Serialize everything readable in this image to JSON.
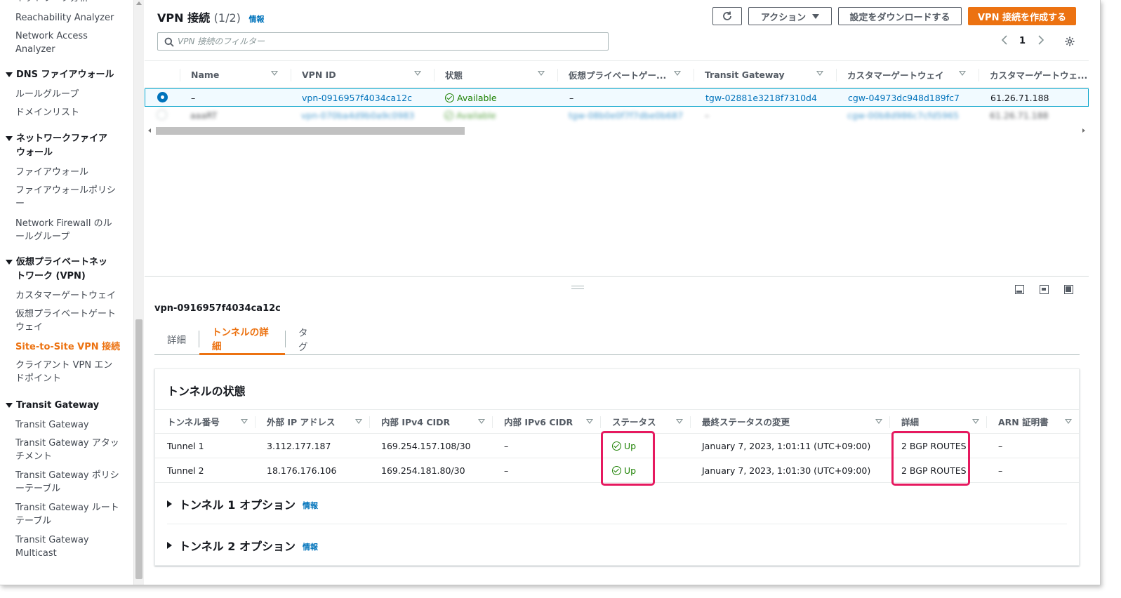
{
  "sidebar": {
    "items": [
      {
        "type": "item",
        "label": "Reachability Analyzer"
      },
      {
        "type": "item",
        "label": "Network Access Analyzer"
      },
      {
        "type": "head",
        "label": "DNS ファイアウォール"
      },
      {
        "type": "item",
        "label": "ルールグループ"
      },
      {
        "type": "item",
        "label": "ドメインリスト"
      },
      {
        "type": "head",
        "label": "ネットワークファイアウォール"
      },
      {
        "type": "item",
        "label": "ファイアウォール"
      },
      {
        "type": "item",
        "label": "ファイアウォールポリシー"
      },
      {
        "type": "item",
        "label": "Network Firewall のルールグループ"
      },
      {
        "type": "head",
        "label": "仮想プライベートネットワーク (VPN)"
      },
      {
        "type": "item",
        "label": "カスタマーゲートウェイ"
      },
      {
        "type": "item",
        "label": "仮想プライベートゲートウェイ"
      },
      {
        "type": "item",
        "label": "Site-to-Site VPN 接続",
        "active": true
      },
      {
        "type": "item",
        "label": "クライアント VPN エンドポイント"
      },
      {
        "type": "head",
        "label": "Transit Gateway"
      },
      {
        "type": "item",
        "label": "Transit Gateway"
      },
      {
        "type": "item",
        "label": "Transit Gateway アタッチメント"
      },
      {
        "type": "item",
        "label": "Transit Gateway ポリシーテーブル"
      },
      {
        "type": "item",
        "label": "Transit Gateway ルートテーブル"
      },
      {
        "type": "item",
        "label": "Transit Gateway Multicast"
      }
    ]
  },
  "header": {
    "title": "VPN 接続",
    "count": "(1/2)",
    "info": "情報",
    "actions_label": "アクション",
    "download_label": "設定をダウンロードする",
    "create_label": "VPN 接続を作成する"
  },
  "filter": {
    "placeholder": "VPN 接続のフィルター"
  },
  "pager": {
    "page": "1"
  },
  "grid": {
    "columns": [
      "Name",
      "VPN ID",
      "状態",
      "仮想プライベートゲー...",
      "Transit Gateway",
      "カスタマーゲートウェイ",
      "カスタマーゲートウェ..."
    ],
    "rows": [
      [
        "–",
        "vpn-0916957f4034ca12c",
        "Available",
        "–",
        "tgw-02881e3218f7310d4",
        "cgw-04973dc948d189fc7",
        "61.26.71.188"
      ],
      [
        "aaaRT",
        "vpn-070ba4d9b0a9c0983",
        "Available",
        "–",
        "tgw-08b0e0f7f7dbe0b687",
        "cgw-00b8d986c7cfd5965",
        "61.26.71.188"
      ]
    ]
  },
  "detail": {
    "id": "vpn-0916957f4034ca12c",
    "tabs": [
      "詳細",
      "トンネルの詳細",
      "タグ"
    ],
    "active_tab": 1,
    "container_title": "トンネルの状態",
    "columns": [
      "トンネル番号",
      "外部 IP アドレス",
      "内部 IPv4 CIDR",
      "内部 IPv6 CIDR",
      "ステータス",
      "最終ステータスの変更",
      "詳細",
      "ARN 証明書"
    ],
    "rows": [
      [
        "Tunnel 1",
        "3.112.177.187",
        "169.254.157.108/30",
        "–",
        "Up",
        "January 7, 2023, 1:01:11 (UTC+09:00)",
        "2 BGP ROUTES",
        "–"
      ],
      [
        "Tunnel 2",
        "18.176.176.106",
        "169.254.181.80/30",
        "–",
        "Up",
        "January 7, 2023, 1:01:30 (UTC+09:00)",
        "2 BGP ROUTES",
        "–"
      ]
    ],
    "options": [
      {
        "label": "トンネル 1 オプション",
        "info": "情報"
      },
      {
        "label": "トンネル 2 オプション",
        "info": "情報"
      }
    ]
  },
  "colors": {
    "accent": "#ec7211",
    "link": "#0073bb",
    "success": "#1d8102",
    "highlight": "#e6195f"
  }
}
